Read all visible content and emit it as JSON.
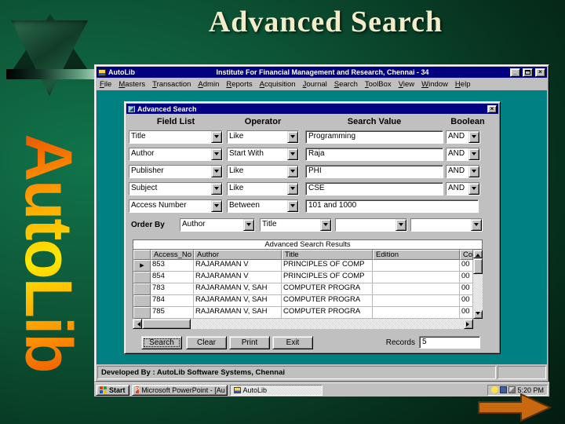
{
  "slide": {
    "title": "Advanced Search",
    "brand": "AutoLib"
  },
  "window": {
    "app_name": "AutoLib",
    "caption": "Institute For Financial Management and Research, Chennai - 34",
    "menu": [
      "File",
      "Masters",
      "Transaction",
      "Admin",
      "Reports",
      "Acquisition",
      "Journal",
      "Search",
      "ToolBox",
      "View",
      "Window",
      "Help"
    ],
    "status": "Developed By : AutoLib Software Systems, Chennai"
  },
  "dialog": {
    "title": "Advanced Search",
    "headers": [
      "Field List",
      "Operator",
      "Search Value",
      "Boolean"
    ],
    "criteria": [
      {
        "field": "Title",
        "operator": "Like",
        "value": "Programming",
        "boolean": "AND"
      },
      {
        "field": "Author",
        "operator": "Start With",
        "value": "Raja",
        "boolean": "AND"
      },
      {
        "field": "Publisher",
        "operator": "Like",
        "value": "PHI",
        "boolean": "AND"
      },
      {
        "field": "Subject",
        "operator": "Like",
        "value": "CSE",
        "boolean": "AND"
      },
      {
        "field": "Access Number",
        "operator": "Between",
        "value": "101 and 1000",
        "boolean": ""
      }
    ],
    "order_by": {
      "label": "Order By",
      "values": [
        "Author",
        "Title",
        "",
        ""
      ]
    },
    "results": {
      "caption": "Advanced Search Results",
      "columns": [
        "Access_No",
        "Author",
        "Title",
        "Edition",
        "Co"
      ],
      "rows": [
        [
          "853",
          "RAJARAMAN V",
          "PRINCIPLES OF COMP",
          "",
          "00"
        ],
        [
          "854",
          "RAJARAMAN V",
          "PRINCIPLES OF COMP",
          "",
          "00"
        ],
        [
          "783",
          "RAJARAMAN V, SAH",
          "COMPUTER PROGRA",
          "",
          "00"
        ],
        [
          "784",
          "RAJARAMAN V, SAH",
          "COMPUTER PROGRA",
          "",
          "00"
        ],
        [
          "785",
          "RAJARAMAN V, SAH",
          "COMPUTER PROGRA",
          "",
          "00"
        ]
      ]
    },
    "buttons": {
      "search": "Search",
      "clear": "Clear",
      "print": "Print",
      "exit": "Exit"
    },
    "records_label": "Records",
    "records_value": "5"
  },
  "taskbar": {
    "start": "Start",
    "task_powerpoint": "Microsoft PowerPoint - [Au",
    "task_autolib": "AutoLib",
    "clock": "5:20 PM"
  },
  "icons": {
    "close": "×",
    "minimize": "_",
    "row_marker": "▶",
    "powerpoint_glyph": "P"
  },
  "colors": {
    "titlebar": "#000080",
    "client_area": "#008080",
    "chrome": "#c0c0c0",
    "slide_green": "#11744b",
    "slide_title_text": "#f1edcb",
    "brand_gradient": [
      "#d92e00",
      "#ff8f00",
      "#ffe800"
    ],
    "nav_arrow": "#c8690f"
  }
}
